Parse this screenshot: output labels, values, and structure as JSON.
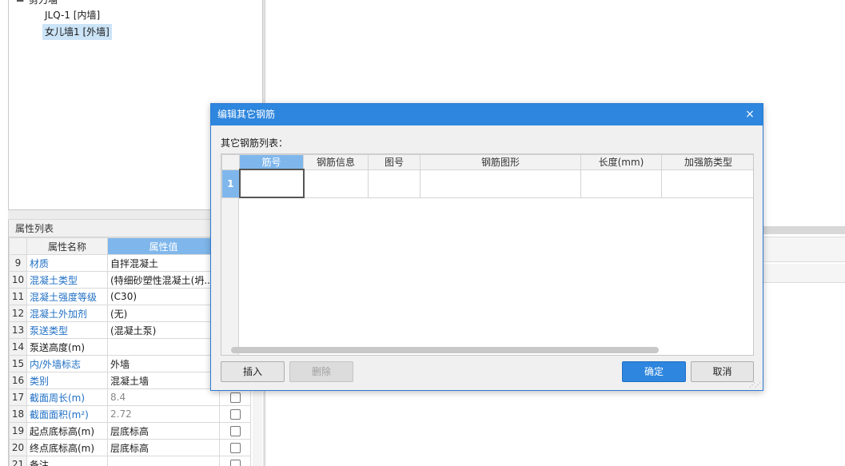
{
  "tree": {
    "parent_label": "剪力墙",
    "items": [
      {
        "label": "JLQ-1 [内墙]",
        "selected": false
      },
      {
        "label": "女儿墙1 [外墙]",
        "selected": true
      }
    ]
  },
  "properties": {
    "title": "属性列表",
    "headers": {
      "name": "属性名称",
      "value": "属性值"
    },
    "rows": [
      {
        "num": "9",
        "name": "材质",
        "value": "自拌混凝土",
        "blue": true,
        "gray": false,
        "checkbox": false
      },
      {
        "num": "10",
        "name": "混凝土类型",
        "value": "(特细砂塑性混凝土(坍...",
        "blue": true,
        "gray": false,
        "checkbox": false
      },
      {
        "num": "11",
        "name": "混凝土强度等级",
        "value": "(C30)",
        "blue": true,
        "gray": false,
        "checkbox": false
      },
      {
        "num": "12",
        "name": "混凝土外加剂",
        "value": "(无)",
        "blue": true,
        "gray": false,
        "checkbox": false
      },
      {
        "num": "13",
        "name": "泵送类型",
        "value": "(混凝土泵)",
        "blue": true,
        "gray": false,
        "checkbox": false
      },
      {
        "num": "14",
        "name": "泵送高度(m)",
        "value": "",
        "blue": false,
        "gray": false,
        "checkbox": false
      },
      {
        "num": "15",
        "name": "内/外墙标志",
        "value": "外墙",
        "blue": true,
        "gray": false,
        "checkbox": false
      },
      {
        "num": "16",
        "name": "类别",
        "value": "混凝土墙",
        "blue": true,
        "gray": false,
        "checkbox": false
      },
      {
        "num": "17",
        "name": "截面周长(m)",
        "value": "8.4",
        "blue": true,
        "gray": true,
        "checkbox": true
      },
      {
        "num": "18",
        "name": "截面面积(m²)",
        "value": "2.72",
        "blue": true,
        "gray": true,
        "checkbox": true
      },
      {
        "num": "19",
        "name": "起点底标高(m)",
        "value": "层底标高",
        "blue": false,
        "gray": false,
        "checkbox": true
      },
      {
        "num": "20",
        "name": "终点底标高(m)",
        "value": "层底标高",
        "blue": false,
        "gray": false,
        "checkbox": true
      },
      {
        "num": "21",
        "name": "备注",
        "value": "",
        "blue": false,
        "gray": false,
        "checkbox": true
      }
    ]
  },
  "dialog": {
    "title": "编辑其它钢筋",
    "close_glyph": "×",
    "list_label": "其它钢筋列表：",
    "columns": [
      "筋号",
      "钢筋信息",
      "图号",
      "钢筋图形",
      "长度(mm)",
      "加强筋类型"
    ],
    "rows": [
      {
        "num": "1",
        "cells": [
          "",
          "",
          "",
          "",
          "",
          ""
        ]
      }
    ],
    "buttons": {
      "insert": "插入",
      "delete": "删除",
      "ok": "确定",
      "cancel": "取消"
    }
  },
  "colors": {
    "accent": "#2e86de",
    "header_active": "#7fb7ec",
    "link_blue": "#1f6fc5"
  }
}
